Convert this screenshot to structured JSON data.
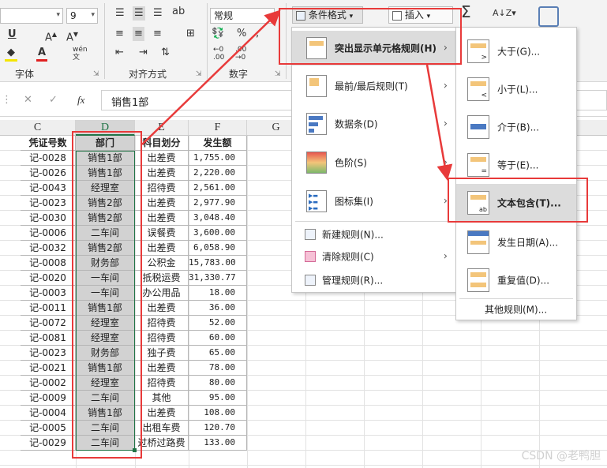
{
  "ribbon": {
    "font_size": "9",
    "number_format": "常规",
    "group_font": "字体",
    "group_align": "对齐方式",
    "group_number": "数字",
    "cond_format_btn": "条件格式",
    "insert_btn": "插入",
    "sum_glyph": "Σ",
    "wrap_glyph": "ab",
    "wen_glyph": "wén"
  },
  "formula_bar": {
    "value": "销售1部",
    "fx": "fx"
  },
  "columns": [
    "C",
    "D",
    "E",
    "F",
    "G"
  ],
  "table": {
    "headers": {
      "voucher": "凭证号数",
      "dept": "部门",
      "subject": "科目划分",
      "amount": "发生额"
    },
    "rows": [
      {
        "voucher": "记-0028",
        "dept": "销售1部",
        "subject": "出差费",
        "amount": "1,755.00"
      },
      {
        "voucher": "记-0026",
        "dept": "销售1部",
        "subject": "出差费",
        "amount": "2,220.00"
      },
      {
        "voucher": "记-0043",
        "dept": "经理室",
        "subject": "招待费",
        "amount": "2,561.00"
      },
      {
        "voucher": "记-0023",
        "dept": "销售2部",
        "subject": "出差费",
        "amount": "2,977.90"
      },
      {
        "voucher": "记-0030",
        "dept": "销售2部",
        "subject": "出差费",
        "amount": "3,048.40"
      },
      {
        "voucher": "记-0006",
        "dept": "二车间",
        "subject": "误餐费",
        "amount": "3,600.00"
      },
      {
        "voucher": "记-0032",
        "dept": "销售2部",
        "subject": "出差费",
        "amount": "6,058.90"
      },
      {
        "voucher": "记-0008",
        "dept": "财务部",
        "subject": "公积金",
        "amount": "15,783.00"
      },
      {
        "voucher": "记-0020",
        "dept": "一车间",
        "subject": "抵税运费",
        "amount": "31,330.77"
      },
      {
        "voucher": "记-0003",
        "dept": "一车间",
        "subject": "办公用品",
        "amount": "18.00"
      },
      {
        "voucher": "记-0011",
        "dept": "销售1部",
        "subject": "出差费",
        "amount": "36.00"
      },
      {
        "voucher": "记-0072",
        "dept": "经理室",
        "subject": "招待费",
        "amount": "52.00"
      },
      {
        "voucher": "记-0081",
        "dept": "经理室",
        "subject": "招待费",
        "amount": "60.00"
      },
      {
        "voucher": "记-0023",
        "dept": "财务部",
        "subject": "独子费",
        "amount": "65.00"
      },
      {
        "voucher": "记-0021",
        "dept": "销售1部",
        "subject": "出差费",
        "amount": "78.00"
      },
      {
        "voucher": "记-0002",
        "dept": "经理室",
        "subject": "招待费",
        "amount": "80.00"
      },
      {
        "voucher": "记-0009",
        "dept": "二车间",
        "subject": "其他",
        "amount": "95.00"
      },
      {
        "voucher": "记-0004",
        "dept": "销售1部",
        "subject": "出差费",
        "amount": "108.00"
      },
      {
        "voucher": "记-0005",
        "dept": "二车间",
        "subject": "出租车费",
        "amount": "120.70"
      },
      {
        "voucher": "记-0029",
        "dept": "二车间",
        "subject": "过桥过路费",
        "amount": "133.00"
      }
    ]
  },
  "cf_menu": {
    "highlight_rules": "突出显示单元格规则(H)",
    "top_bottom": "最前/最后规则(T)",
    "data_bars": "数据条(D)",
    "color_scales": "色阶(S)",
    "icon_sets": "图标集(I)",
    "new_rule": "新建规则(N)...",
    "clear_rules": "清除规则(C)",
    "manage_rules": "管理规则(R)..."
  },
  "submenu": {
    "greater": "大于(G)...",
    "less": "小于(L)...",
    "between": "介于(B)...",
    "equal": "等于(E)...",
    "text_contains": "文本包含(T)...",
    "date_occurring": "发生日期(A)...",
    "duplicate": "重复值(D)...",
    "more_rules": "其他规则(M)..."
  },
  "watermark": "CSDN @老鸭胆",
  "colors": {
    "selection_green": "#217346",
    "red_box": "#e83a3a",
    "header_bg": "#efefef"
  }
}
